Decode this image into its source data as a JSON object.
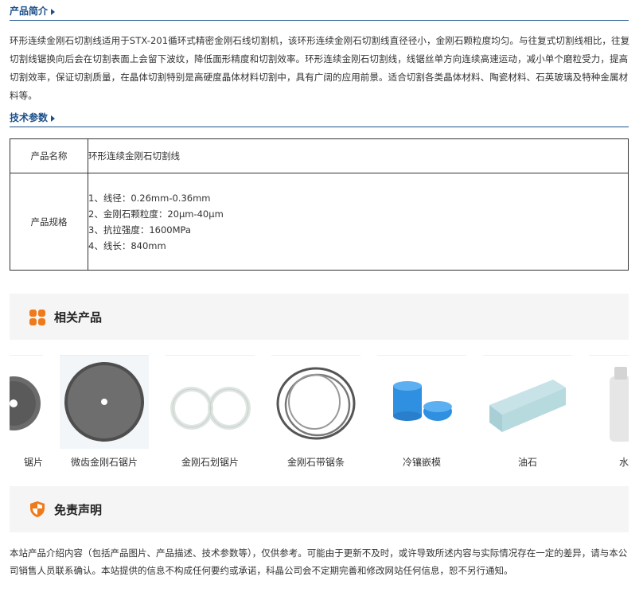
{
  "intro_section": {
    "title": "产品简介",
    "text": "环形连续金刚石切割线适用于STX-201循环式精密金刚石线切割机，该环形连续金刚石切割线直径径小，金刚石颗粒度均匀。与往复式切割线相比，往复切割线锯换向后会在切割表面上会留下波纹，降低面形精度和切割效率。环形连续金刚石切割线，线锯丝单方向连续高速运动，减小单个磨粒受力，提高切割效率，保证切割质量，在晶体切割特别是高硬度晶体材料切割中，具有广阔的应用前景。适合切割各类晶体材料、陶瓷材料、石英玻璃及特种金属材料等。"
  },
  "params_section": {
    "title": "技术参数",
    "name_label": "产品名称",
    "name_value": "环形连续金刚石切割线",
    "spec_label": "产品规格",
    "specs": [
      "1、线径：0.26mm-0.36mm",
      "2、金刚石颗粒度：20μm-40μm",
      "3、抗拉强度：1600MPa",
      "4、线长：840mm"
    ]
  },
  "related": {
    "title": "相关产品",
    "icon": "grid-icon",
    "items": [
      {
        "label": "锯片"
      },
      {
        "label": "微齿金刚石锯片"
      },
      {
        "label": "金刚石划锯片"
      },
      {
        "label": "金刚石带锯条"
      },
      {
        "label": "冷镶嵌模"
      },
      {
        "label": "油石"
      },
      {
        "label": "水"
      }
    ]
  },
  "disclaimer": {
    "title": "免责声明",
    "icon": "shield-icon",
    "text": "本站产品介绍内容（包括产品图片、产品描述、技术参数等），仅供参考。可能由于更新不及时，或许导致所述内容与实际情况存在一定的差异，请与本公司销售人员联系确认。本站提供的信息不构成任何要约或承诺，科晶公司会不定期完善和修改网站任何信息，恕不另行通知。"
  },
  "colors": {
    "accent": "#1b4f8a",
    "orange": "#f07a1a",
    "panel_bg": "#f5f5f5"
  }
}
